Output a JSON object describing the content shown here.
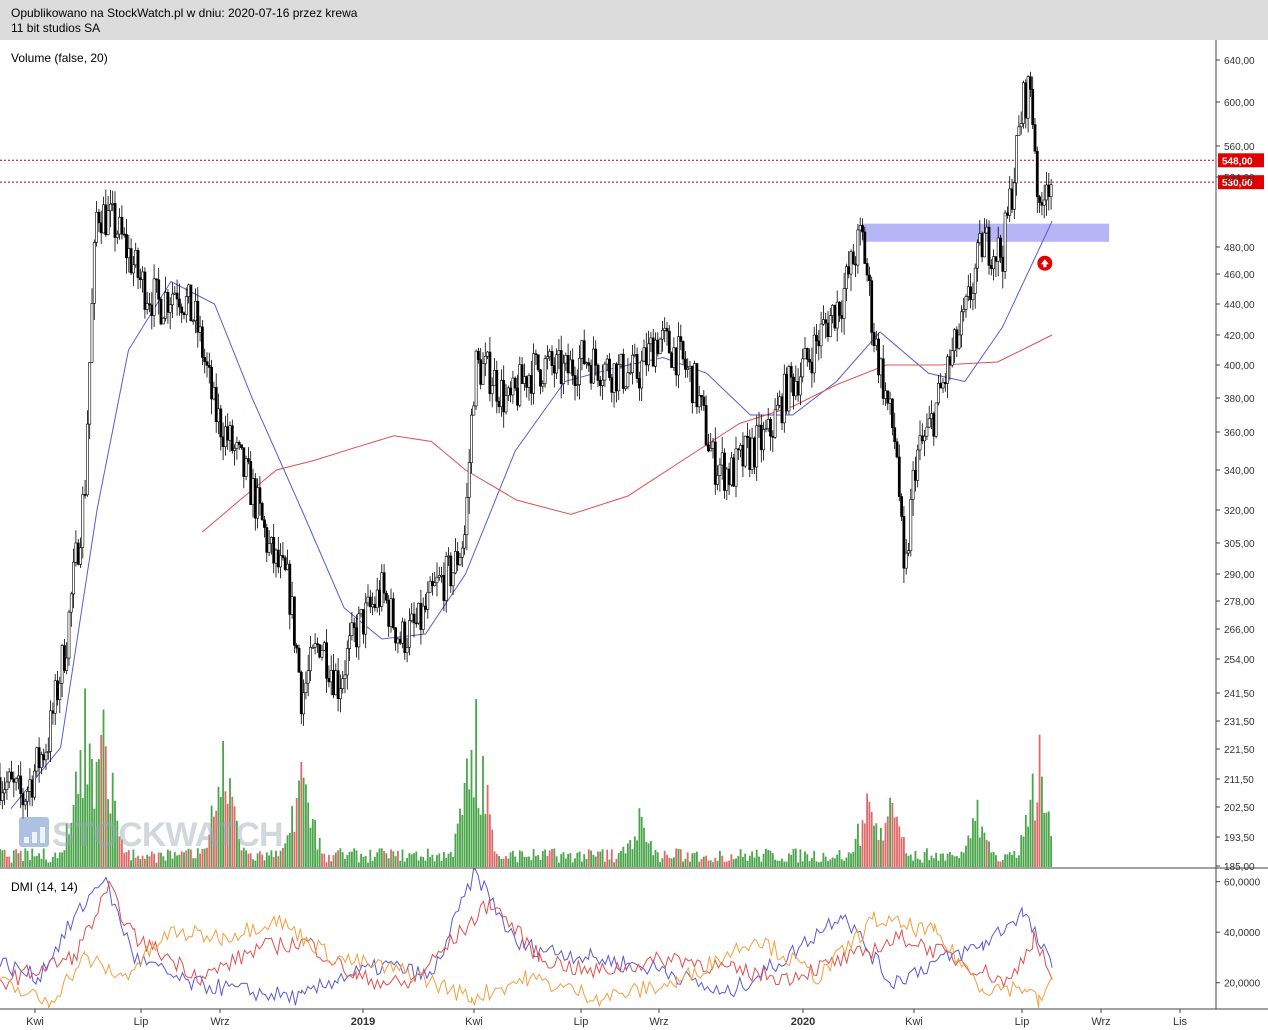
{
  "header": {
    "published": "Opublikowano na StockWatch.pl w dniu: 2020-07-16 przez krewa",
    "company": "11 bit studios SA"
  },
  "main_panel": {
    "label": "Volume (false, 20)",
    "watermark": "STOCKWATCH"
  },
  "dmi_panel": {
    "label": "DMI (14, 14)",
    "ticks": [
      "60,0000",
      "40,0000",
      "20,0000"
    ]
  },
  "x_axis": {
    "ticks": [
      "Kwi",
      "Lip",
      "Wrz",
      "2019",
      "Kwi",
      "Lip",
      "Wrz",
      "2020",
      "Kwi",
      "Lip",
      "Wrz",
      "Lis"
    ],
    "bold": [
      "2019",
      "2020"
    ]
  },
  "colors": {
    "ma_short": "#5a5ad6",
    "ma_long": "#e05050",
    "zone": "#a9a9f5",
    "level_line": "#b00000",
    "vol_up": "#4aa64a",
    "vol_down": "#e06a6a",
    "dmi_plus": "#5a5ad6",
    "dmi_minus": "#e05050",
    "adx": "#f0a040",
    "price_tag": "#e00000"
  },
  "chart_data": [
    {
      "type": "candlestick",
      "title": "11 bit studios SA",
      "y_axis": {
        "ticks": [
          640,
          600,
          560,
          534,
          480,
          460,
          440,
          420,
          400,
          380,
          360,
          340,
          320,
          305,
          290,
          278,
          266,
          254,
          241.5,
          231.5,
          221.5,
          211.5,
          202.5,
          193.5,
          185
        ],
        "tick_labels": [
          "640,00",
          "600,00",
          "560,00",
          "534,00",
          "480,00",
          "460,00",
          "440,00",
          "420,00",
          "400,00",
          "380,00",
          "360,00",
          "340,00",
          "320,00",
          "305,00",
          "290,00",
          "278,00",
          "266,00",
          "254,00",
          "241,50",
          "231,50",
          "221,50",
          "211,50",
          "202,50",
          "193,50",
          "185,00"
        ],
        "scale": "log-like"
      },
      "x_range": [
        "2018-03",
        "2020-11"
      ],
      "price_path": [
        {
          "x": "2018-03-01",
          "close": 212
        },
        {
          "x": "2018-03-20",
          "close": 205
        },
        {
          "x": "2018-04-10",
          "close": 225
        },
        {
          "x": "2018-04-25",
          "close": 262
        },
        {
          "x": "2018-05-10",
          "close": 330
        },
        {
          "x": "2018-05-20",
          "close": 510
        },
        {
          "x": "2018-06-05",
          "close": 495
        },
        {
          "x": "2018-06-25",
          "close": 455
        },
        {
          "x": "2018-07-10",
          "close": 440
        },
        {
          "x": "2018-07-25",
          "close": 452
        },
        {
          "x": "2018-08-10",
          "close": 428
        },
        {
          "x": "2018-08-25",
          "close": 372
        },
        {
          "x": "2018-09-10",
          "close": 350
        },
        {
          "x": "2018-09-25",
          "close": 330
        },
        {
          "x": "2018-10-10",
          "close": 300
        },
        {
          "x": "2018-10-25",
          "close": 285
        },
        {
          "x": "2018-11-05",
          "close": 240
        },
        {
          "x": "2018-11-20",
          "close": 262
        },
        {
          "x": "2018-12-05",
          "close": 245
        },
        {
          "x": "2018-12-20",
          "close": 265
        },
        {
          "x": "2019-01-10",
          "close": 282
        },
        {
          "x": "2019-01-25",
          "close": 262
        },
        {
          "x": "2019-02-10",
          "close": 268
        },
        {
          "x": "2019-02-25",
          "close": 285
        },
        {
          "x": "2019-03-10",
          "close": 292
        },
        {
          "x": "2019-03-20",
          "close": 310
        },
        {
          "x": "2019-03-28",
          "close": 400
        },
        {
          "x": "2019-04-10",
          "close": 395
        },
        {
          "x": "2019-04-25",
          "close": 375
        },
        {
          "x": "2019-05-10",
          "close": 395
        },
        {
          "x": "2019-05-25",
          "close": 400
        },
        {
          "x": "2019-06-10",
          "close": 395
        },
        {
          "x": "2019-06-25",
          "close": 405
        },
        {
          "x": "2019-07-10",
          "close": 400
        },
        {
          "x": "2019-07-25",
          "close": 395
        },
        {
          "x": "2019-08-10",
          "close": 395
        },
        {
          "x": "2019-08-25",
          "close": 418
        },
        {
          "x": "2019-09-10",
          "close": 408
        },
        {
          "x": "2019-09-25",
          "close": 388
        },
        {
          "x": "2019-10-10",
          "close": 345
        },
        {
          "x": "2019-10-25",
          "close": 338
        },
        {
          "x": "2019-11-10",
          "close": 350
        },
        {
          "x": "2019-11-25",
          "close": 358
        },
        {
          "x": "2019-12-10",
          "close": 385
        },
        {
          "x": "2019-12-25",
          "close": 400
        },
        {
          "x": "2020-01-10",
          "close": 425
        },
        {
          "x": "2020-01-25",
          "close": 445
        },
        {
          "x": "2020-02-10",
          "close": 490
        },
        {
          "x": "2020-02-20",
          "close": 420
        },
        {
          "x": "2020-03-01",
          "close": 380
        },
        {
          "x": "2020-03-10",
          "close": 350
        },
        {
          "x": "2020-03-16",
          "close": 282
        },
        {
          "x": "2020-03-25",
          "close": 345
        },
        {
          "x": "2020-04-05",
          "close": 360
        },
        {
          "x": "2020-04-20",
          "close": 395
        },
        {
          "x": "2020-05-05",
          "close": 430
        },
        {
          "x": "2020-05-20",
          "close": 485
        },
        {
          "x": "2020-06-05",
          "close": 475
        },
        {
          "x": "2020-06-15",
          "close": 540
        },
        {
          "x": "2020-06-22",
          "close": 600
        },
        {
          "x": "2020-06-28",
          "close": 615
        },
        {
          "x": "2020-07-02",
          "close": 560
        },
        {
          "x": "2020-07-06",
          "close": 492
        },
        {
          "x": "2020-07-10",
          "close": 538
        },
        {
          "x": "2020-07-16",
          "close": 530
        }
      ],
      "moving_averages": [
        {
          "color": "#5a5ad6",
          "values": [
            {
              "x": "2018-03-10",
              "y": 202
            },
            {
              "x": "2018-04-20",
              "y": 222
            },
            {
              "x": "2018-05-20",
              "y": 320
            },
            {
              "x": "2018-06-15",
              "y": 410
            },
            {
              "x": "2018-07-20",
              "y": 455
            },
            {
              "x": "2018-08-25",
              "y": 440
            },
            {
              "x": "2018-09-25",
              "y": 380
            },
            {
              "x": "2018-11-05",
              "y": 320
            },
            {
              "x": "2018-12-10",
              "y": 275
            },
            {
              "x": "2019-01-10",
              "y": 262
            },
            {
              "x": "2019-02-15",
              "y": 264
            },
            {
              "x": "2019-03-20",
              "y": 290
            },
            {
              "x": "2019-04-30",
              "y": 350
            },
            {
              "x": "2019-06-10",
              "y": 390
            },
            {
              "x": "2019-07-20",
              "y": 398
            },
            {
              "x": "2019-08-30",
              "y": 405
            },
            {
              "x": "2019-10-05",
              "y": 395
            },
            {
              "x": "2019-11-10",
              "y": 370
            },
            {
              "x": "2019-12-15",
              "y": 370
            },
            {
              "x": "2020-01-20",
              "y": 390
            },
            {
              "x": "2020-02-25",
              "y": 422
            },
            {
              "x": "2020-04-05",
              "y": 395
            },
            {
              "x": "2020-05-05",
              "y": 390
            },
            {
              "x": "2020-06-05",
              "y": 425
            },
            {
              "x": "2020-07-16",
              "y": 500
            }
          ]
        },
        {
          "color": "#e05050",
          "values": [
            {
              "x": "2018-08-15",
              "y": 310
            },
            {
              "x": "2018-09-15",
              "y": 325
            },
            {
              "x": "2018-10-15",
              "y": 340
            },
            {
              "x": "2018-11-15",
              "y": 345
            },
            {
              "x": "2018-12-20",
              "y": 352
            },
            {
              "x": "2019-01-20",
              "y": 358
            },
            {
              "x": "2019-02-20",
              "y": 355
            },
            {
              "x": "2019-03-20",
              "y": 340
            },
            {
              "x": "2019-05-01",
              "y": 325
            },
            {
              "x": "2019-06-15",
              "y": 318
            },
            {
              "x": "2019-08-01",
              "y": 327
            },
            {
              "x": "2019-09-15",
              "y": 345
            },
            {
              "x": "2019-11-01",
              "y": 365
            },
            {
              "x": "2019-12-15",
              "y": 375
            },
            {
              "x": "2020-01-20",
              "y": 388
            },
            {
              "x": "2020-03-01",
              "y": 400
            },
            {
              "x": "2020-04-15",
              "y": 400
            },
            {
              "x": "2020-06-01",
              "y": 402
            },
            {
              "x": "2020-07-16",
              "y": 420
            }
          ]
        }
      ],
      "horizontal_levels": [
        {
          "value": 548,
          "label": "548,00"
        },
        {
          "value": 530,
          "label": "530,00"
        }
      ],
      "zone": {
        "x_start": "2020-02-10",
        "x_end": "2020-09-01",
        "y_low": 484,
        "y_high": 498
      },
      "annotation": {
        "type": "up-arrow",
        "x": "2020-07-10",
        "y": 468
      }
    },
    {
      "type": "bar",
      "title": "Volume (false, 20)",
      "peaks": [
        {
          "x": "2018-05-10",
          "value": 0.85
        },
        {
          "x": "2018-05-25",
          "value": 0.75
        },
        {
          "x": "2018-09-01",
          "value": 0.6
        },
        {
          "x": "2018-11-05",
          "value": 0.5
        },
        {
          "x": "2019-03-28",
          "value": 0.8
        },
        {
          "x": "2019-08-10",
          "value": 0.28
        },
        {
          "x": "2020-02-15",
          "value": 0.35
        },
        {
          "x": "2020-03-05",
          "value": 0.33
        },
        {
          "x": "2020-05-15",
          "value": 0.32
        },
        {
          "x": "2020-07-06",
          "value": 0.63
        }
      ]
    },
    {
      "type": "line",
      "title": "DMI (14, 14)",
      "ylim": [
        10,
        65
      ],
      "series": [
        {
          "color": "#5a5ad6",
          "values": [
            {
              "x": "2018-03-01",
              "y": 28
            },
            {
              "x": "2018-04-01",
              "y": 22
            },
            {
              "x": "2018-05-01",
              "y": 45
            },
            {
              "x": "2018-05-25",
              "y": 62
            },
            {
              "x": "2018-06-20",
              "y": 30
            },
            {
              "x": "2018-08-01",
              "y": 20
            },
            {
              "x": "2018-09-01",
              "y": 18
            },
            {
              "x": "2018-10-01",
              "y": 16
            },
            {
              "x": "2018-11-05",
              "y": 14
            },
            {
              "x": "2018-12-05",
              "y": 22
            },
            {
              "x": "2019-01-15",
              "y": 27
            },
            {
              "x": "2019-02-20",
              "y": 22
            },
            {
              "x": "2019-03-28",
              "y": 64
            },
            {
              "x": "2019-05-01",
              "y": 35
            },
            {
              "x": "2019-07-01",
              "y": 30
            },
            {
              "x": "2019-09-01",
              "y": 25
            },
            {
              "x": "2019-10-20",
              "y": 15
            },
            {
              "x": "2019-12-10",
              "y": 30
            },
            {
              "x": "2020-01-25",
              "y": 48
            },
            {
              "x": "2020-03-05",
              "y": 20
            },
            {
              "x": "2020-04-10",
              "y": 28
            },
            {
              "x": "2020-05-20",
              "y": 35
            },
            {
              "x": "2020-06-22",
              "y": 48
            },
            {
              "x": "2020-07-16",
              "y": 26
            }
          ]
        },
        {
          "color": "#e05050",
          "values": [
            {
              "x": "2018-03-01",
              "y": 20
            },
            {
              "x": "2018-05-01",
              "y": 30
            },
            {
              "x": "2018-05-30",
              "y": 57
            },
            {
              "x": "2018-06-20",
              "y": 38
            },
            {
              "x": "2018-08-15",
              "y": 22
            },
            {
              "x": "2018-10-01",
              "y": 34
            },
            {
              "x": "2018-11-10",
              "y": 36
            },
            {
              "x": "2018-12-20",
              "y": 22
            },
            {
              "x": "2019-02-01",
              "y": 19
            },
            {
              "x": "2019-04-10",
              "y": 52
            },
            {
              "x": "2019-05-20",
              "y": 30
            },
            {
              "x": "2019-07-01",
              "y": 24
            },
            {
              "x": "2019-09-10",
              "y": 30
            },
            {
              "x": "2019-10-25",
              "y": 25
            },
            {
              "x": "2019-12-10",
              "y": 22
            },
            {
              "x": "2020-02-01",
              "y": 30
            },
            {
              "x": "2020-03-15",
              "y": 38
            },
            {
              "x": "2020-04-25",
              "y": 30
            },
            {
              "x": "2020-06-10",
              "y": 20
            },
            {
              "x": "2020-07-01",
              "y": 38
            },
            {
              "x": "2020-07-16",
              "y": 22
            }
          ]
        },
        {
          "color": "#f0a040",
          "values": [
            {
              "x": "2018-03-01",
              "y": 20
            },
            {
              "x": "2018-04-10",
              "y": 12
            },
            {
              "x": "2018-05-10",
              "y": 30
            },
            {
              "x": "2018-06-10",
              "y": 22
            },
            {
              "x": "2018-07-20",
              "y": 40
            },
            {
              "x": "2018-09-01",
              "y": 38
            },
            {
              "x": "2018-10-15",
              "y": 45
            },
            {
              "x": "2018-12-01",
              "y": 30
            },
            {
              "x": "2019-02-01",
              "y": 24
            },
            {
              "x": "2019-03-25",
              "y": 14
            },
            {
              "x": "2019-05-10",
              "y": 22
            },
            {
              "x": "2019-07-10",
              "y": 14
            },
            {
              "x": "2019-09-10",
              "y": 20
            },
            {
              "x": "2019-11-15",
              "y": 38
            },
            {
              "x": "2020-01-05",
              "y": 22
            },
            {
              "x": "2020-02-20",
              "y": 45
            },
            {
              "x": "2020-04-10",
              "y": 40
            },
            {
              "x": "2020-05-20",
              "y": 18
            },
            {
              "x": "2020-06-25",
              "y": 18
            },
            {
              "x": "2020-07-05",
              "y": 12
            },
            {
              "x": "2020-07-16",
              "y": 22
            }
          ]
        }
      ]
    }
  ]
}
